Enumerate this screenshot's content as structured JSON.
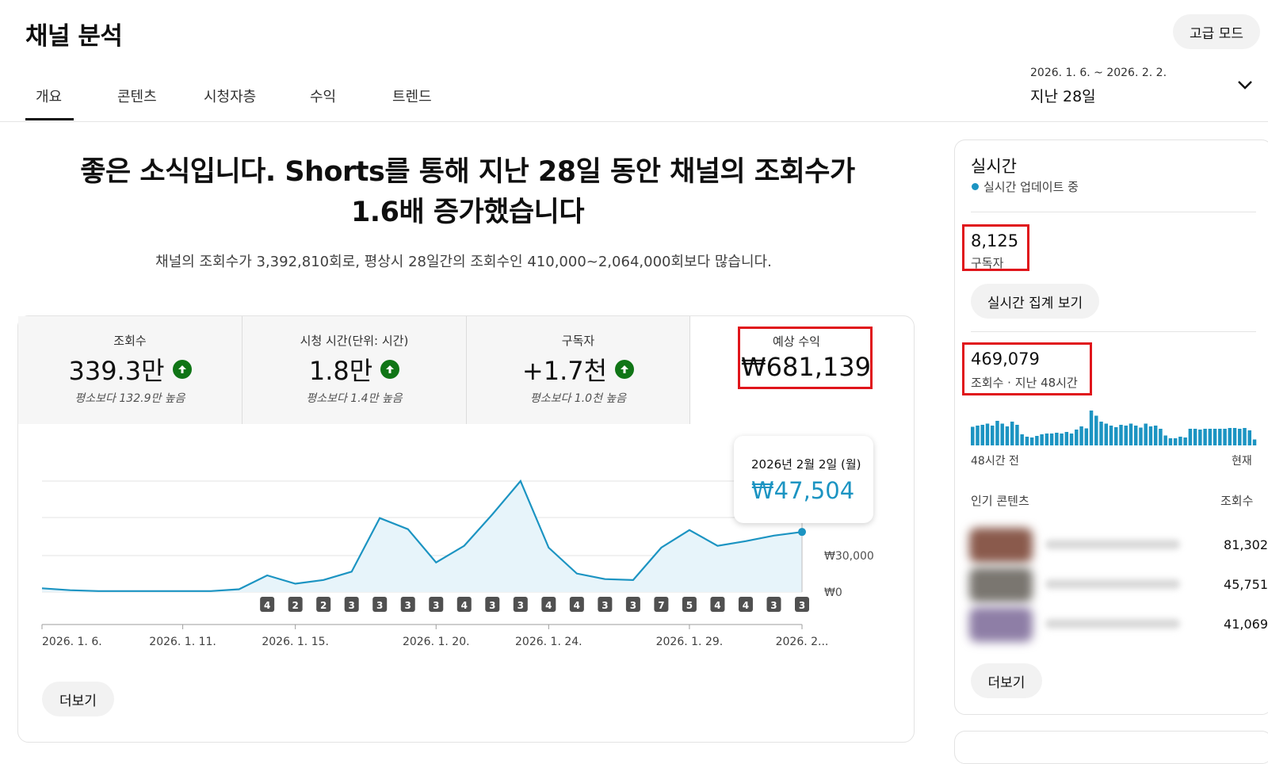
{
  "header": {
    "title": "채널 분석",
    "advanced_mode": "고급 모드",
    "tabs": [
      "개요",
      "콘텐츠",
      "시청자층",
      "수익",
      "트렌드"
    ],
    "date_range": "2026. 1. 6. ~ 2026. 2. 2.",
    "date_label": "지난 28일"
  },
  "headline": {
    "line1": "좋은 소식입니다. Shorts를 통해 지난 28일 동안 채널의 조회수가",
    "line2": "1.6배 증가했습니다",
    "subtext": "채널의 조회수가 3,392,810회로, 평상시 28일간의 조회수인 410,000~2,064,000회보다 많습니다."
  },
  "metrics": [
    {
      "label": "조회수",
      "value": "339.3만",
      "note": "평소보다 132.9만 높음",
      "trend": "up"
    },
    {
      "label": "시청 시간(단위: 시간)",
      "value": "1.8만",
      "note": "평소보다 1.4만 높음",
      "trend": "up"
    },
    {
      "label": "구독자",
      "value": "+1.7천",
      "note": "평소보다 1.0천 높음",
      "trend": "up"
    }
  ],
  "revenue": {
    "label": "예상 수익",
    "value": "₩681,139"
  },
  "tooltip": {
    "date": "2026년 2월 2일 (월)",
    "value": "₩47,504"
  },
  "chart_data": {
    "type": "area",
    "x": [
      "2026-01-06",
      "2026-01-07",
      "2026-01-08",
      "2026-01-09",
      "2026-01-10",
      "2026-01-11",
      "2026-01-12",
      "2026-01-13",
      "2026-01-14",
      "2026-01-15",
      "2026-01-16",
      "2026-01-17",
      "2026-01-18",
      "2026-01-19",
      "2026-01-20",
      "2026-01-21",
      "2026-01-22",
      "2026-01-23",
      "2026-01-24",
      "2026-01-25",
      "2026-01-26",
      "2026-01-27",
      "2026-01-28",
      "2026-01-29",
      "2026-01-30",
      "2026-01-31",
      "2026-02-01",
      "2026-02-02"
    ],
    "values": [
      2000,
      1000,
      500,
      500,
      500,
      500,
      500,
      1500,
      9000,
      4500,
      6500,
      11000,
      40000,
      34000,
      16000,
      25000,
      42000,
      60000,
      24000,
      10000,
      7000,
      6500,
      24000,
      33500,
      25000,
      27500,
      30500,
      32500
    ],
    "ylim": [
      0,
      60000
    ],
    "ytick_labels": [
      "₩30,000",
      "₩0"
    ],
    "xtick_labels": [
      "2026. 1. 6.",
      "2026. 1. 11.",
      "2026. 1. 15.",
      "2026. 1. 20.",
      "2026. 1. 24.",
      "2026. 1. 29.",
      "2026. 2..."
    ],
    "xtick_dates": [
      "2026-01-06",
      "2026-01-11",
      "2026-01-15",
      "2026-01-20",
      "2026-01-24",
      "2026-01-29",
      "2026-02-02"
    ],
    "upload_markers": [
      {
        "date": "2026-01-14",
        "count": "4"
      },
      {
        "date": "2026-01-15",
        "count": "2"
      },
      {
        "date": "2026-01-16",
        "count": "2"
      },
      {
        "date": "2026-01-17",
        "count": "3"
      },
      {
        "date": "2026-01-18",
        "count": "3"
      },
      {
        "date": "2026-01-19",
        "count": "3"
      },
      {
        "date": "2026-01-20",
        "count": "3"
      },
      {
        "date": "2026-01-21",
        "count": "4"
      },
      {
        "date": "2026-01-22",
        "count": "3"
      },
      {
        "date": "2026-01-23",
        "count": "3"
      },
      {
        "date": "2026-01-24",
        "count": "4"
      },
      {
        "date": "2026-01-25",
        "count": "4"
      },
      {
        "date": "2026-01-26",
        "count": "3"
      },
      {
        "date": "2026-01-27",
        "count": "3"
      },
      {
        "date": "2026-01-28",
        "count": "7"
      },
      {
        "date": "2026-01-29",
        "count": "5"
      },
      {
        "date": "2026-01-30",
        "count": "4"
      },
      {
        "date": "2026-01-31",
        "count": "4"
      },
      {
        "date": "2026-02-01",
        "count": "3"
      },
      {
        "date": "2026-02-02",
        "count": "3"
      }
    ],
    "line_color": "#1c94c2",
    "fill_color": "#e7f4fa"
  },
  "main_more": "더보기",
  "realtime": {
    "title": "실시간",
    "status": "실시간 업데이트 중",
    "subscribers": "8,125",
    "subscribers_label": "구독자",
    "view_button": "실시간 집계 보기",
    "views": "469,079",
    "views_label": "조회수 · 지난 48시간",
    "hourly_bars": [
      0.47,
      0.5,
      0.52,
      0.55,
      0.5,
      0.62,
      0.55,
      0.48,
      0.6,
      0.52,
      0.28,
      0.22,
      0.2,
      0.24,
      0.28,
      0.3,
      0.3,
      0.32,
      0.3,
      0.34,
      0.3,
      0.4,
      0.48,
      0.43,
      0.88,
      0.75,
      0.6,
      0.55,
      0.5,
      0.46,
      0.52,
      0.5,
      0.55,
      0.5,
      0.45,
      0.55,
      0.48,
      0.5,
      0.42,
      0.25,
      0.18,
      0.18,
      0.22,
      0.2,
      0.42,
      0.42,
      0.4,
      0.42,
      0.42,
      0.42,
      0.42,
      0.42,
      0.44,
      0.44,
      0.42,
      0.44,
      0.38,
      0.15
    ],
    "bar_color": "#1c94c2",
    "start_label": "48시간 전",
    "end_label": "현재",
    "popular_label": "인기 콘텐츠",
    "popular_col": "조회수",
    "popular": [
      {
        "views": "81,302",
        "thumb": "#8a5a4c"
      },
      {
        "views": "45,751",
        "thumb": "#7a7670"
      },
      {
        "views": "41,069",
        "thumb": "#8e7ea6"
      }
    ],
    "more": "더보기"
  }
}
